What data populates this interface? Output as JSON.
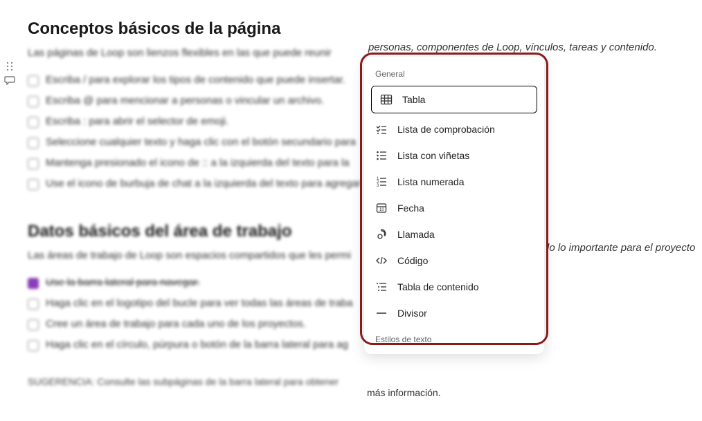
{
  "page": {
    "heading1": "Conceptos básicos de la página",
    "intro1_blurred": "Las páginas de Loop son lienzos flexibles en las que puede reunir",
    "intro1_trailing": "personas, componentes de Loop, vínculos, tareas y contenido.",
    "list1": [
      "Escriba / para explorar los tipos de contenido que puede insertar.",
      "Escriba @ para mencionar a personas o vincular un archivo.",
      "Escriba : para abrir el selector de emoji.",
      "Seleccione cualquier texto y haga clic con el botón secundario para",
      "Mantenga presionado el icono de :: a la izquierda del texto para la",
      "Use el icono de burbuja de chat a la izquierda del texto para agregar"
    ],
    "heading2": "Datos básicos del área de trabajo",
    "intro2_blurred": "Las áreas de trabajo de Loop son espacios compartidos que les permi",
    "intro2_trailing": "lo lo importante para el proyecto",
    "list2": [
      {
        "text": "Use la barra lateral para navegar.",
        "checked": true
      },
      {
        "text": "Haga clic en el logotipo del bucle para ver todas las áreas de traba",
        "checked": false
      },
      {
        "text": "Cree un área de trabajo para cada uno de los proyectos.",
        "checked": false
      },
      {
        "text": "Haga clic en el círculo, púrpura o botón de la barra lateral para ag",
        "checked": false
      }
    ],
    "suggestion_blurred": "SUGERENCIA: Consulte las subpáginas de la barra lateral para obtener",
    "suggestion_trailing": "más información."
  },
  "dropdown": {
    "section_general": "General",
    "section_styles": "Estilos de texto",
    "items": [
      {
        "label": "Tabla",
        "icon": "table"
      },
      {
        "label": "Lista de comprobación",
        "icon": "checklist"
      },
      {
        "label": "Lista con viñetas",
        "icon": "bullet-list"
      },
      {
        "label": "Lista numerada",
        "icon": "numbered-list"
      },
      {
        "label": "Fecha",
        "icon": "date"
      },
      {
        "label": "Llamada",
        "icon": "call"
      },
      {
        "label": "Código",
        "icon": "code"
      },
      {
        "label": "Tabla de contenido",
        "icon": "toc"
      },
      {
        "label": "Divisor",
        "icon": "divider"
      }
    ]
  }
}
